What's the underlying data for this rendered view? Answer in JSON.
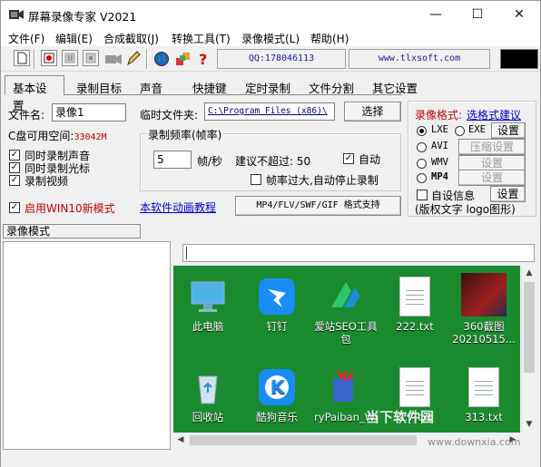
{
  "window": {
    "title": "屏幕录像专家 V2021",
    "controls": [
      "minimize",
      "maximize",
      "close"
    ]
  },
  "menu": [
    "文件(F)",
    "编辑(E)",
    "合成截取(J)",
    "转换工具(T)",
    "录像模式(L)",
    "帮助(H)"
  ],
  "toolbar": {
    "qq": "QQ:178046113",
    "website": "www.tlxsoft.com"
  },
  "tabs": [
    "基本设置",
    "录制目标",
    "声音",
    "快捷键",
    "定时录制",
    "文件分割",
    "其它设置"
  ],
  "basic": {
    "filename_label": "文件名:",
    "filename_value": "录像1",
    "tempfolder_label": "临时文件夹:",
    "tempfolder_value": "C:\\Program Files (x86)\\",
    "choose_button": "选择",
    "disk_label": "C盘可用空间:",
    "disk_value": "33042M",
    "checkbox_sound": "同时录制声音",
    "checkbox_cursor": "同时录制光标",
    "checkbox_video": "录制视频",
    "win10_label": "启用WIN10新模式",
    "fps_group": "录制频率(帧率)",
    "fps_value": "5",
    "fps_unit": "帧/秒",
    "fps_suggest": "建议不超过: 50",
    "auto_label": "自动",
    "too_high_label": "帧率过大,自动停止录制",
    "tutorial_link": "本软件动画教程",
    "format_support_button": "MP4/FLV/SWF/GIF  格式支持"
  },
  "format": {
    "label": "录像格式:",
    "suggest_link": "选格式建议",
    "options": [
      {
        "name": "LXE",
        "selected": true
      },
      {
        "name": "EXE",
        "selected": false
      },
      {
        "name": "AVI",
        "selected": false
      },
      {
        "name": "WMV",
        "selected": false
      },
      {
        "name": "MP4",
        "selected": false
      }
    ],
    "settings_button": "设置",
    "compress_button": "压缩设置",
    "custom_info_label": "自设信息",
    "copyright_label": "(版权文字 logo图形)"
  },
  "record_mode_label": "录像模式",
  "desktop": {
    "icons": [
      {
        "label": "此电脑",
        "icon": "computer-icon"
      },
      {
        "label": "钉钉",
        "icon": "dingtalk-icon"
      },
      {
        "label": "爱站SEO工具包",
        "icon": "seo-tool-icon"
      },
      {
        "label": "222.txt",
        "icon": "text-file-icon"
      },
      {
        "label": "360截图20210515...",
        "icon": "screenshot-image-icon"
      },
      {
        "label": "回收站",
        "icon": "recycle-bin-icon"
      },
      {
        "label": "酷狗音乐",
        "icon": "kugou-icon"
      },
      {
        "label": "ryPaiban_Wi",
        "icon": "paiban-icon"
      },
      {
        "label": "2.7.txt",
        "icon": "text-file-icon"
      },
      {
        "label": "313.txt",
        "icon": "text-file-icon"
      }
    ]
  },
  "watermark": {
    "text": "当下软件园",
    "url": "www.downxia.com"
  },
  "colors": {
    "desktop_bg": "#1a8a2e",
    "red_text": "#c00000",
    "link_blue": "#0000d0"
  }
}
